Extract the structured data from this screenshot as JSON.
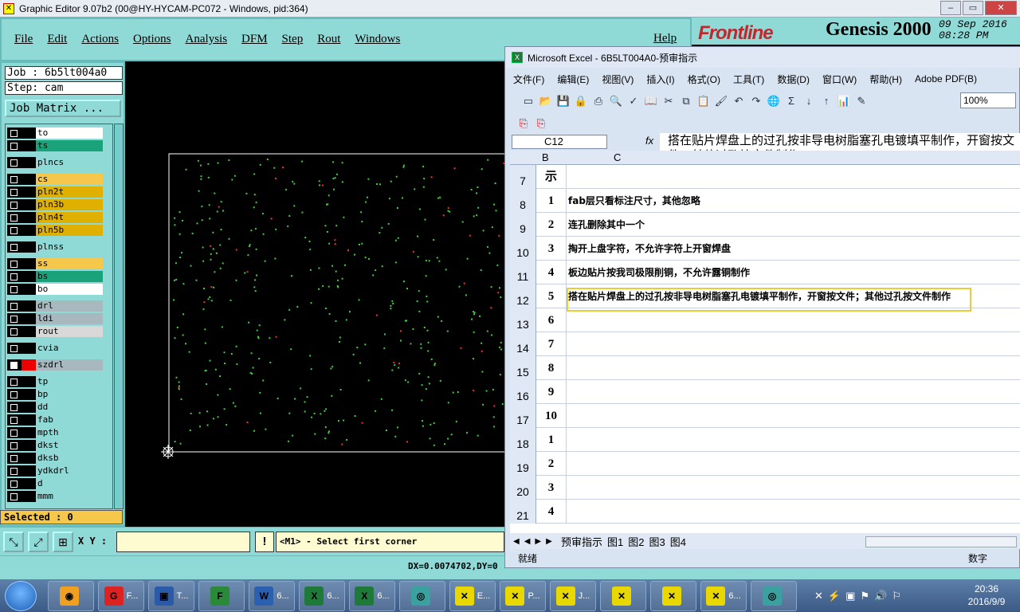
{
  "ge": {
    "title": "Graphic Editor 9.07b2 (00@HY-HYCAM-PC072 - Windows, pid:364)",
    "menu": [
      "File",
      "Edit",
      "Actions",
      "Options",
      "Analysis",
      "DFM",
      "Step",
      "Rout",
      "Windows"
    ],
    "help": "Help",
    "brand": "Frontline",
    "product": "Genesis 2000",
    "date": "09 Sep 2016",
    "time": "08:28 PM",
    "job": "Job : 6b5lt004a0",
    "step": "Step: cam",
    "job_matrix": "Job Matrix ...",
    "layers": [
      {
        "name": "to",
        "color": "#ffffff",
        "sel": false
      },
      {
        "name": "ts",
        "color": "#1aa37a",
        "sel": false
      },
      {
        "name": "plncs",
        "color": "#8fd9d6",
        "sel": false
      },
      {
        "name": "cs",
        "color": "#f5c84c",
        "sel": false
      },
      {
        "name": "pln2t",
        "color": "#e0b000",
        "sel": false
      },
      {
        "name": "pln3b",
        "color": "#e0b000",
        "sel": false
      },
      {
        "name": "pln4t",
        "color": "#e0b000",
        "sel": false
      },
      {
        "name": "pln5b",
        "color": "#e0b000",
        "sel": false
      },
      {
        "name": "plnss",
        "color": "#8fd9d6",
        "sel": false
      },
      {
        "name": "ss",
        "color": "#f5c84c",
        "sel": false
      },
      {
        "name": "bs",
        "color": "#1aa37a",
        "sel": false
      },
      {
        "name": "bo",
        "color": "#ffffff",
        "sel": false
      },
      {
        "name": "drl",
        "color": "#a8b8bf",
        "sel": false
      },
      {
        "name": "ldi",
        "color": "#a8b8bf",
        "sel": false
      },
      {
        "name": "rout",
        "color": "#d8d8d8",
        "sel": false
      },
      {
        "name": "cvia",
        "color": "#8fd9d6",
        "sel": false
      },
      {
        "name": "szdrl",
        "color": "#a8b8bf",
        "sel": true
      },
      {
        "name": "tp",
        "color": "#8fd9d6",
        "sel": false
      },
      {
        "name": "bp",
        "color": "#8fd9d6",
        "sel": false
      },
      {
        "name": "dd",
        "color": "#8fd9d6",
        "sel": false
      },
      {
        "name": "fab",
        "color": "#8fd9d6",
        "sel": false
      },
      {
        "name": "mpth",
        "color": "#8fd9d6",
        "sel": false
      },
      {
        "name": "dkst",
        "color": "#8fd9d6",
        "sel": false
      },
      {
        "name": "dksb",
        "color": "#8fd9d6",
        "sel": false
      },
      {
        "name": "ydkdrl",
        "color": "#8fd9d6",
        "sel": false
      },
      {
        "name": "d",
        "color": "#8fd9d6",
        "sel": false
      },
      {
        "name": "mmm",
        "color": "#8fd9d6",
        "sel": false
      }
    ],
    "selected": "Selected : 0",
    "xy_label": "X Y :",
    "prompt": "<M1> - Select first corner",
    "coords": "DX=0.0074702,DY=0"
  },
  "excel": {
    "title": "Microsoft Excel - 6B5LT004A0-预审指示",
    "menu": [
      "文件(F)",
      "编辑(E)",
      "视图(V)",
      "插入(I)",
      "格式(O)",
      "工具(T)",
      "数据(D)",
      "窗口(W)",
      "帮助(H)",
      "Adobe PDF(B)"
    ],
    "zoom": "100%",
    "namebox": "C12",
    "fx": "fx",
    "formula": "搭在贴片焊盘上的过孔按非导电树脂塞孔电镀填平制作，开窗按文件；其他过孔按文件制作",
    "col_b": "B",
    "col_c": "C",
    "rows": [
      {
        "r": "7",
        "b": "示",
        "c": ""
      },
      {
        "r": "8",
        "b": "1",
        "c": "fab层只看标注尺寸，其他忽略"
      },
      {
        "r": "9",
        "b": "2",
        "c": "连孔删除其中一个"
      },
      {
        "r": "10",
        "b": "3",
        "c": "掏开上盘字符，不允许字符上开窗焊盘"
      },
      {
        "r": "11",
        "b": "4",
        "c": "板边贴片按我司极限削铜，不允许露铜制作"
      },
      {
        "r": "12",
        "b": "5",
        "c": "搭在贴片焊盘上的过孔按非导电树脂塞孔电镀填平制作，开窗按文件；其他过孔按文件制作"
      },
      {
        "r": "13",
        "b": "6",
        "c": ""
      },
      {
        "r": "14",
        "b": "7",
        "c": ""
      },
      {
        "r": "15",
        "b": "8",
        "c": ""
      },
      {
        "r": "16",
        "b": "9",
        "c": ""
      },
      {
        "r": "17",
        "b": "10",
        "c": ""
      },
      {
        "r": "18",
        "b": "1",
        "c": ""
      },
      {
        "r": "19",
        "b": "2",
        "c": ""
      },
      {
        "r": "20",
        "b": "3",
        "c": ""
      },
      {
        "r": "21",
        "b": "4",
        "c": ""
      }
    ],
    "tabs": [
      "预审指示",
      "图1",
      "图2",
      "图3",
      "图4"
    ],
    "status": "就绪",
    "status_right": "数字"
  },
  "taskbar": {
    "items": [
      {
        "label": "",
        "icon": "shell-icon",
        "color": "#f0a020"
      },
      {
        "label": "F...",
        "icon": "frontline-icon",
        "color": "#d22"
      },
      {
        "label": "T...",
        "icon": "floppy-icon",
        "color": "#2a5aa8"
      },
      {
        "label": "",
        "icon": "genesis-f-icon",
        "color": "#2a8a3a"
      },
      {
        "label": "6...",
        "icon": "word-icon",
        "color": "#2b5fb0"
      },
      {
        "label": "6...",
        "icon": "excel-icon",
        "color": "#1f7a3a"
      },
      {
        "label": "6...",
        "icon": "excel-icon",
        "color": "#1f7a3a"
      },
      {
        "label": "",
        "icon": "eye-icon",
        "color": "#3aa0a0"
      },
      {
        "label": "E...",
        "icon": "x-window-icon",
        "color": "#e8d800"
      },
      {
        "label": "P...",
        "icon": "x-window-icon",
        "color": "#e8d800"
      },
      {
        "label": "J...",
        "icon": "x-window-icon",
        "color": "#e8d800"
      },
      {
        "label": "",
        "icon": "x-window-icon",
        "color": "#e8d800"
      },
      {
        "label": "",
        "icon": "x-window-icon",
        "color": "#e8d800"
      },
      {
        "label": "6...",
        "icon": "x-window-icon",
        "color": "#e8d800"
      },
      {
        "label": "",
        "icon": "eye-icon",
        "color": "#3aa0a0"
      }
    ],
    "time": "20:36",
    "date": "2016/9/9"
  }
}
